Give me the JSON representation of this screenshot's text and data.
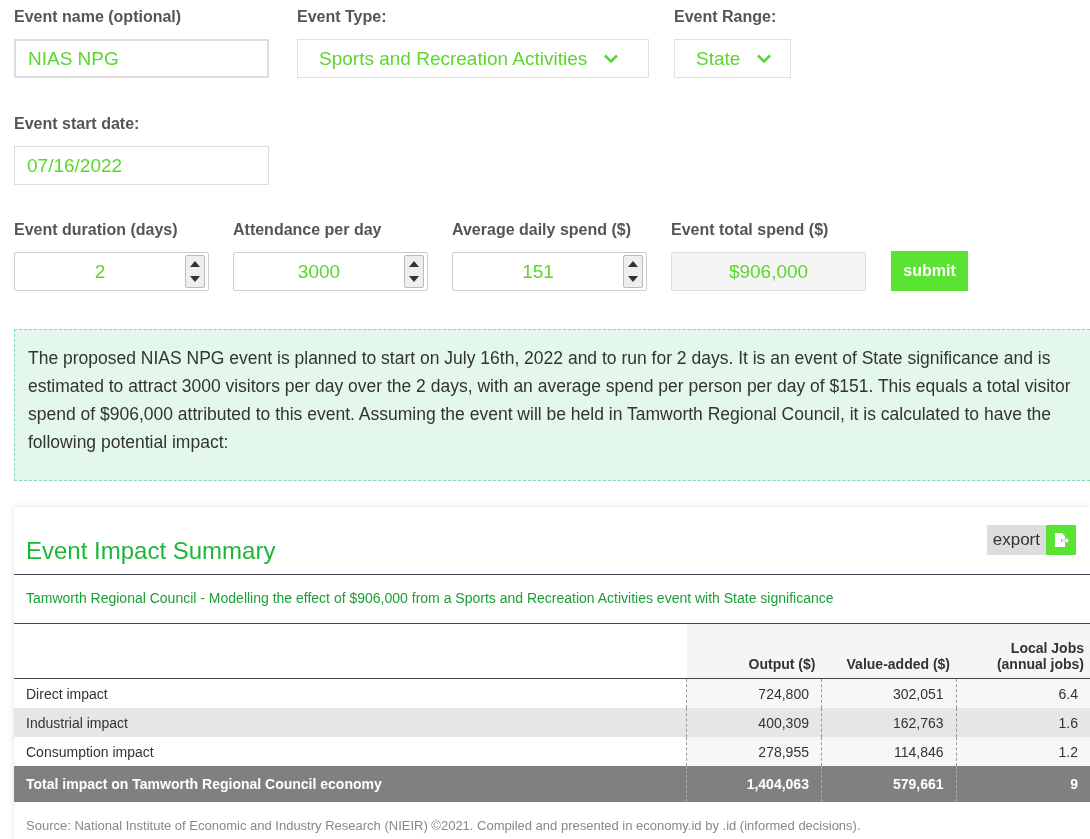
{
  "form": {
    "event_name": {
      "label": "Event name (optional)",
      "value": "NIAS NPG"
    },
    "event_type": {
      "label": "Event Type:",
      "value": "Sports and Recreation Activities"
    },
    "event_range": {
      "label": "Event Range:",
      "value": "State"
    },
    "start_date": {
      "label": "Event start date:",
      "value": "07/16/2022"
    },
    "numbers": [
      {
        "label": "Event duration (days)",
        "value": "2",
        "kind": "spinner"
      },
      {
        "label": "Attendance per day",
        "value": "3000",
        "kind": "spinner"
      },
      {
        "label": "Average daily spend ($)",
        "value": "151",
        "kind": "spinner"
      },
      {
        "label": "Event total spend ($)",
        "value": "$906,000",
        "kind": "readonly"
      }
    ],
    "submit": "submit"
  },
  "summary_text": "The proposed NIAS NPG event is planned to start on July 16th, 2022 and to run for 2 days. It is an event of State significance and is estimated to attract 3000 visitors per day over the 2 days, with an average spend per person per day of $151. This equals a total visitor spend of $906,000 attributed to this event. Assuming the event will be held in Tamworth Regional Council, it is calculated to have the following potential impact:",
  "impact": {
    "title": "Event Impact Summary",
    "export": "export",
    "subtitle": "Tamworth Regional Council - Modelling the effect of $906,000 from a Sports and Recreation Activities event with State significance",
    "columns": [
      "",
      "Output ($)",
      "Value-added ($)",
      "Local Jobs (annual jobs)"
    ],
    "rows": [
      {
        "kind": "row",
        "cells": [
          "Direct impact",
          "724,800",
          "302,051",
          "6.4"
        ]
      },
      {
        "kind": "row",
        "cells": [
          "Industrial impact",
          "400,309",
          "162,763",
          "1.6"
        ]
      },
      {
        "kind": "row",
        "cells": [
          "Consumption impact",
          "278,955",
          "114,846",
          "1.2"
        ]
      },
      {
        "kind": "total",
        "cells": [
          "Total impact on Tamworth Regional Council economy",
          "1,404,063",
          "579,661",
          "9"
        ]
      }
    ],
    "source": "Source: National Institute of Economic and Industry Research (NIEIR) ©2021. Compiled and presented in economy.id by .id (informed decisions)."
  }
}
